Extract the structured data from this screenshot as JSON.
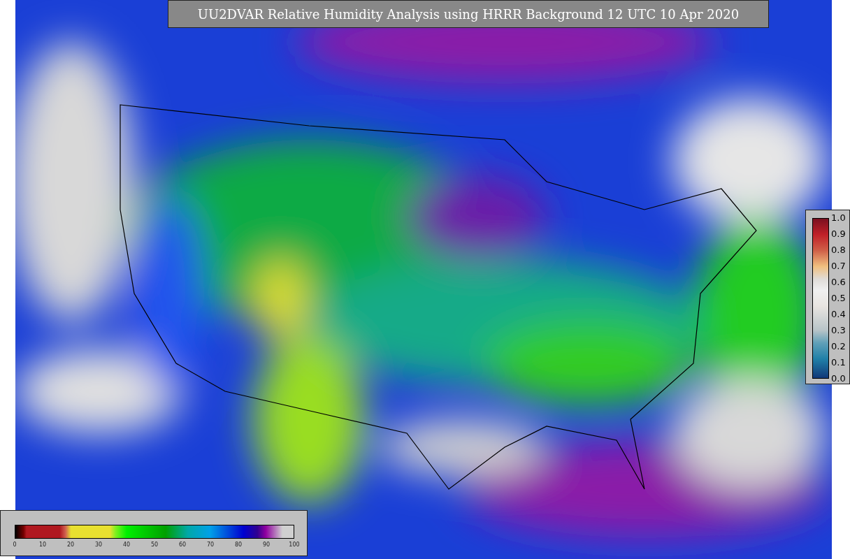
{
  "title": "UU2DVAR Relative Humidity Analysis using HRRR Background 12 UTC 10 Apr 2020",
  "humidity_colorbar": {
    "ticks": [
      "0",
      "10",
      "20",
      "30",
      "40",
      "50",
      "60",
      "70",
      "80",
      "90",
      "100"
    ]
  },
  "ratio_colorbar": {
    "ticks": [
      "1.0",
      "0.9",
      "0.8",
      "0.7",
      "0.6",
      "0.5",
      "0.4",
      "0.3",
      "0.2",
      "0.1",
      "0.0"
    ]
  }
}
